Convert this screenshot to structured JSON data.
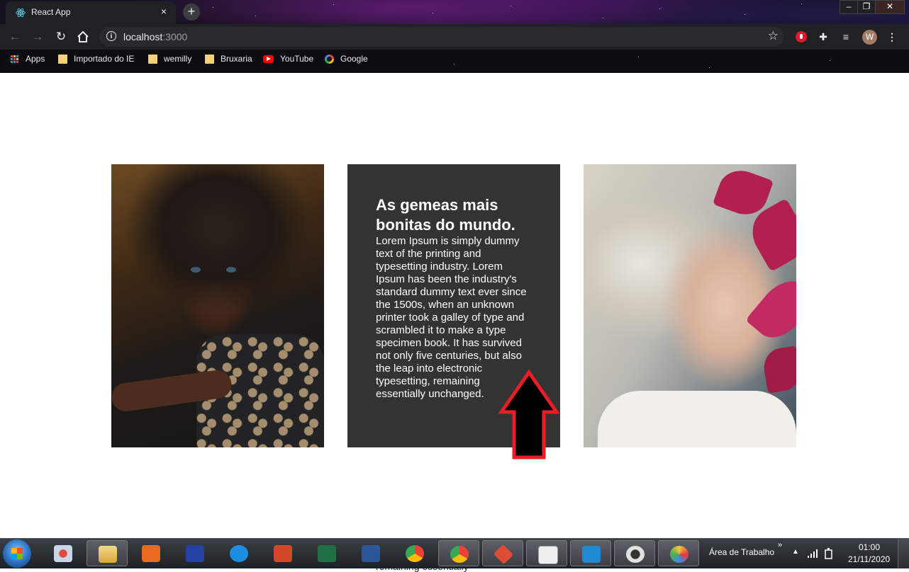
{
  "browser": {
    "tab_title": "React App",
    "tab_close": "×",
    "new_tab": "+",
    "window_controls": [
      "–",
      "❐",
      "✕"
    ],
    "url_host": "localhost",
    "url_port": ":3000",
    "avatar_letter": "W",
    "bookmarks": [
      "Apps",
      "Importado do IE",
      "wemilly",
      "Bruxaria",
      "YouTube",
      "Google"
    ]
  },
  "card": {
    "title": "As gemeas mais bonitas do mundo.",
    "body": "Lorem Ipsum is simply dummy text of the printing and typesetting industry. Lorem Ipsum has been the industry's standard dummy text ever since the 1500s, when an unknown printer took a galley of type and scrambled it to make a type specimen book. It has survived not only five centuries, but also the leap into electronic typesetting, remaining essentially unchanged."
  },
  "overflow_text": "remaining essentially",
  "taskbar": {
    "desktop_label": "Área de Trabalho",
    "chevron": "»",
    "time": "01:00",
    "date": "21/11/2020"
  },
  "colors": {
    "card_bg": "#333333",
    "arrow_stroke": "#e81d25",
    "arrow_fill": "#000000"
  }
}
